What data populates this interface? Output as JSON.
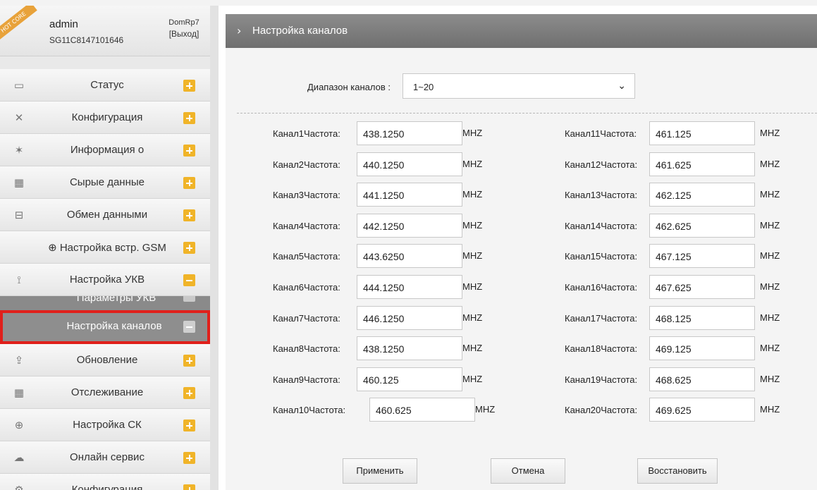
{
  "user": {
    "badge": "HOT CORE",
    "name": "admin",
    "serial": "SG11C8147101646",
    "device": "DomRp7",
    "logout": "[Выход]"
  },
  "menu": [
    {
      "label": "Статус",
      "icon": "monitor-icon",
      "glyph": "▭"
    },
    {
      "label": "Конфигурация",
      "icon": "tools-icon",
      "glyph": "✕"
    },
    {
      "label": "Информация о",
      "icon": "satellite-icon",
      "glyph": "✶"
    },
    {
      "label": "Сырые данные",
      "icon": "calendar-icon",
      "glyph": "▦"
    },
    {
      "label": "Обмен данными",
      "icon": "network-icon",
      "glyph": "⊟"
    },
    {
      "label": "⊕ Настройка встр. GSM",
      "icon": "",
      "glyph": ""
    },
    {
      "label": "Настройка УКВ",
      "icon": "antenna-icon",
      "glyph": "⟟"
    }
  ],
  "submenu": {
    "partial_label": "Параметры УКВ",
    "active_label": "Настройка каналов"
  },
  "menu_bottom": [
    {
      "label": "Обновление",
      "icon": "upload-icon",
      "glyph": "⇪"
    },
    {
      "label": "Отслеживание",
      "icon": "calendar-chart-icon",
      "glyph": "▦"
    },
    {
      "label": "Настройка СК",
      "icon": "globe-icon",
      "glyph": "⊕"
    },
    {
      "label": "Онлайн сервис",
      "icon": "cloud-icon",
      "glyph": "☁"
    },
    {
      "label": "Конфигурация",
      "icon": "user-gear-icon",
      "glyph": "⚙"
    }
  ],
  "page": {
    "title": "Настройка каналов",
    "range_label": "Диапазон каналов :",
    "range_value": "1~20",
    "unit": "MHZ"
  },
  "channels_left": [
    {
      "label": "Канал1Частота:",
      "value": "438.1250"
    },
    {
      "label": "Канал2Частота:",
      "value": "440.1250"
    },
    {
      "label": "Канал3Частота:",
      "value": "441.1250"
    },
    {
      "label": "Канал4Частота:",
      "value": "442.1250"
    },
    {
      "label": "Канал5Частота:",
      "value": "443.6250"
    },
    {
      "label": "Канал6Частота:",
      "value": "444.1250"
    },
    {
      "label": "Канал7Частота:",
      "value": "446.1250"
    },
    {
      "label": "Канал8Частота:",
      "value": "438.1250"
    },
    {
      "label": "Канал9Частота:",
      "value": "460.125"
    },
    {
      "label": "Канал10Частота:",
      "value": "460.625"
    }
  ],
  "channels_right": [
    {
      "label": "Канал11Частота:",
      "value": "461.125"
    },
    {
      "label": "Канал12Частота:",
      "value": "461.625"
    },
    {
      "label": "Канал13Частота:",
      "value": "462.125"
    },
    {
      "label": "Канал14Частота:",
      "value": "462.625"
    },
    {
      "label": "Канал15Частота:",
      "value": "467.125"
    },
    {
      "label": "Канал16Частота:",
      "value": "467.625"
    },
    {
      "label": "Канал17Частота:",
      "value": "468.125"
    },
    {
      "label": "Канал18Частота:",
      "value": "469.125"
    },
    {
      "label": "Канал19Частота:",
      "value": "468.625"
    },
    {
      "label": "Канал20Частота:",
      "value": "469.625"
    }
  ],
  "buttons": {
    "apply": "Применить",
    "cancel": "Отмена",
    "restore": "Восстановить"
  },
  "colors": {
    "accent_plus": "#f0b429",
    "highlight_border": "#e0201b",
    "title_bar": "#7a7a7a"
  }
}
